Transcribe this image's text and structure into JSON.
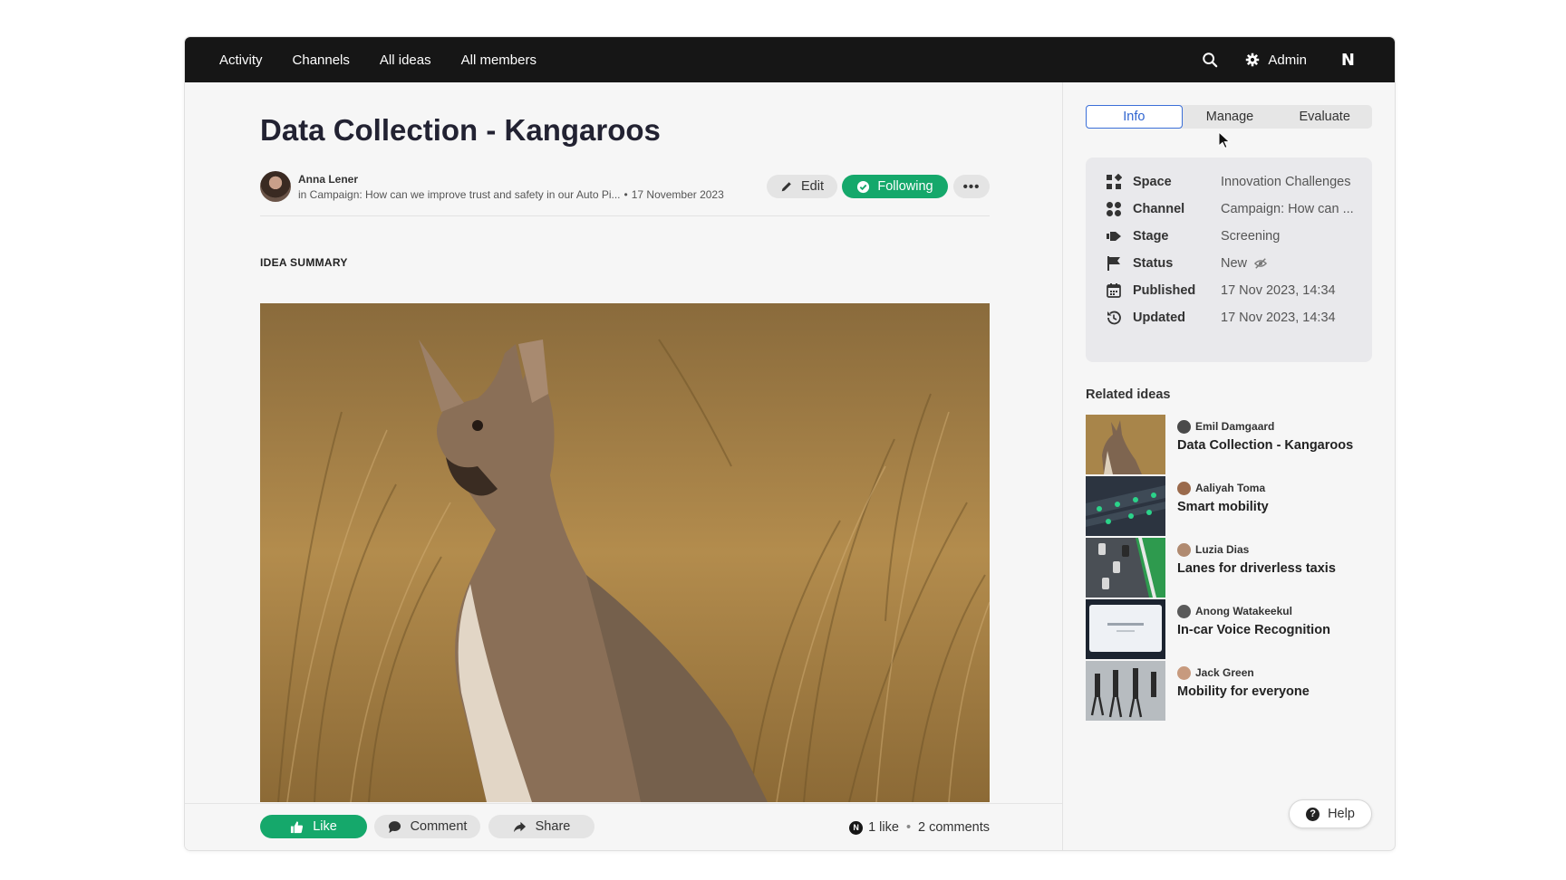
{
  "nav": {
    "items": [
      "Activity",
      "Channels",
      "All ideas",
      "All members"
    ],
    "admin_label": "Admin",
    "logo": "N"
  },
  "idea": {
    "title": "Data Collection - Kangaroos",
    "author": "Anna Lener",
    "campaign": "in Campaign: How can we improve trust and safety in our Auto Pi...",
    "date": "17 November 2023",
    "edit_label": "Edit",
    "following_label": "Following",
    "more_label": "•••",
    "section_label": "IDEA SUMMARY"
  },
  "actions": {
    "like_label": "Like",
    "comment_label": "Comment",
    "share_label": "Share",
    "likes": "1 like",
    "comments": "2 comments"
  },
  "sidebar": {
    "tabs": [
      "Info",
      "Manage",
      "Evaluate"
    ],
    "active_tab": "Info",
    "info": [
      {
        "key": "Space",
        "value": "Innovation Challenges",
        "icon": "space-icon"
      },
      {
        "key": "Channel",
        "value": "Campaign: How can ...",
        "icon": "channel-icon"
      },
      {
        "key": "Stage",
        "value": "Screening",
        "icon": "stage-icon"
      },
      {
        "key": "Status",
        "value": "New",
        "icon": "flag-icon"
      },
      {
        "key": "Published",
        "value": "17 Nov 2023, 14:34",
        "icon": "calendar-icon"
      },
      {
        "key": "Updated",
        "value": "17 Nov 2023, 14:34",
        "icon": "history-icon"
      }
    ],
    "related_title": "Related ideas",
    "related": [
      {
        "author": "Emil Damgaard",
        "title": "Data Collection - Kangaroos"
      },
      {
        "author": "Aaliyah Toma",
        "title": "Smart mobility"
      },
      {
        "author": "Luzia Dias",
        "title": "Lanes for driverless taxis"
      },
      {
        "author": "Anong Watakeekul",
        "title": "In-car Voice Recognition"
      },
      {
        "author": "Jack Green",
        "title": "Mobility for everyone"
      }
    ],
    "help_label": "Help"
  },
  "colors": {
    "nav_bg": "#161616",
    "accent_green": "#15a86b",
    "active_tab_blue": "#2f64d0"
  }
}
